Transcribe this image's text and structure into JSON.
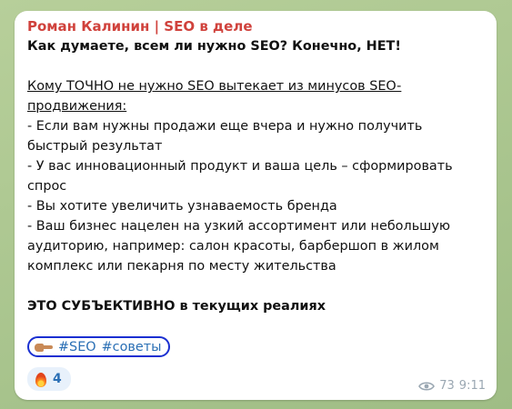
{
  "post": {
    "author": "Роман Калинин | SEO в деле",
    "lines": [
      {
        "text": "Как думаете, всем ли нужно SEO? Конечно, НЕТ!",
        "style": "bold"
      },
      {
        "text": "",
        "style": "gap"
      },
      {
        "text": "Кому ТОЧНО не нужно SEO вытекает из минусов SEO-",
        "style": "underline"
      },
      {
        "text": "продвижения:",
        "style": "underline"
      },
      {
        "text": "- Если вам нужны продажи еще вчера и нужно получить",
        "style": "normal"
      },
      {
        "text": "быстрый результат",
        "style": "normal"
      },
      {
        "text": "- У вас инновационный продукт и ваша цель – сформировать",
        "style": "normal"
      },
      {
        "text": "спрос",
        "style": "normal"
      },
      {
        "text": "- Вы хотите увеличить узнаваемость бренда",
        "style": "normal"
      },
      {
        "text": "- Ваш бизнес нацелен на узкий ассортимент или небольшую",
        "style": "normal"
      },
      {
        "text": "аудиторию, например: салон красоты, барбершоп в жилом",
        "style": "normal"
      },
      {
        "text": "комплекс или пекарня по месту жительства",
        "style": "normal"
      },
      {
        "text": "",
        "style": "gap"
      },
      {
        "text": "ЭТО СУБЪЕКТИВНО в текущих реалиях",
        "style": "bold"
      }
    ],
    "hashtags": [
      "#SEO",
      "#советы"
    ],
    "reaction": {
      "icon": "fire-icon",
      "count": "4"
    },
    "views": "73",
    "time": "9:11",
    "colors": {
      "author": "#d0423c",
      "link": "#2a6fb5",
      "highlight_border": "#1a2fd1"
    }
  }
}
